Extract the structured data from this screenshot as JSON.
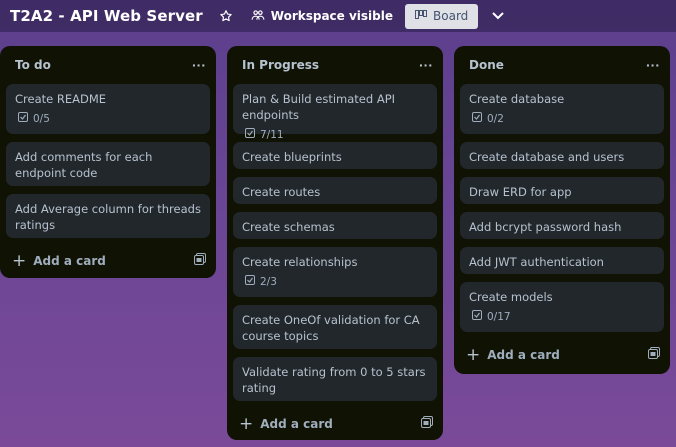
{
  "header": {
    "title": "T2A2 - API Web Server",
    "visibility_label": "Workspace visible",
    "view_label": "Board"
  },
  "lists": [
    {
      "title": "To do",
      "cards": [
        {
          "title": "Create README",
          "checklist": "0/5"
        },
        {
          "title": "Add comments for each endpoint code"
        },
        {
          "title": "Add Average column for threads ratings"
        }
      ],
      "add_label": "Add a card"
    },
    {
      "title": "In Progress",
      "cards": [
        {
          "title": "Plan & Build estimated API endpoints",
          "checklist": "7/11"
        },
        {
          "title": "Create blueprints"
        },
        {
          "title": "Create routes"
        },
        {
          "title": "Create schemas"
        },
        {
          "title": "Create relationships",
          "checklist": "2/3"
        },
        {
          "title": "Create OneOf validation for CA course topics"
        },
        {
          "title": "Validate rating from 0 to 5 stars rating"
        }
      ],
      "add_label": "Add a card"
    },
    {
      "title": "Done",
      "cards": [
        {
          "title": "Create database",
          "checklist": "0/2"
        },
        {
          "title": "Create database and users"
        },
        {
          "title": "Draw ERD for app"
        },
        {
          "title": "Add bcrypt password hash"
        },
        {
          "title": "Add JWT authentication"
        },
        {
          "title": "Create models",
          "checklist": "0/17"
        }
      ],
      "add_label": "Add a card"
    }
  ],
  "icons": {
    "star": "star-icon",
    "visibility": "workspace-visibility-icon",
    "board": "board-icon",
    "chevron": "chevron-down-icon",
    "menu": "more-icon",
    "checklist": "checklist-icon",
    "template": "card-template-icon"
  },
  "colors": {
    "list_bg": "#101204",
    "card_bg": "#22272b",
    "text": "#b6c2cf",
    "board_button_bg": "#dfe1e6"
  }
}
